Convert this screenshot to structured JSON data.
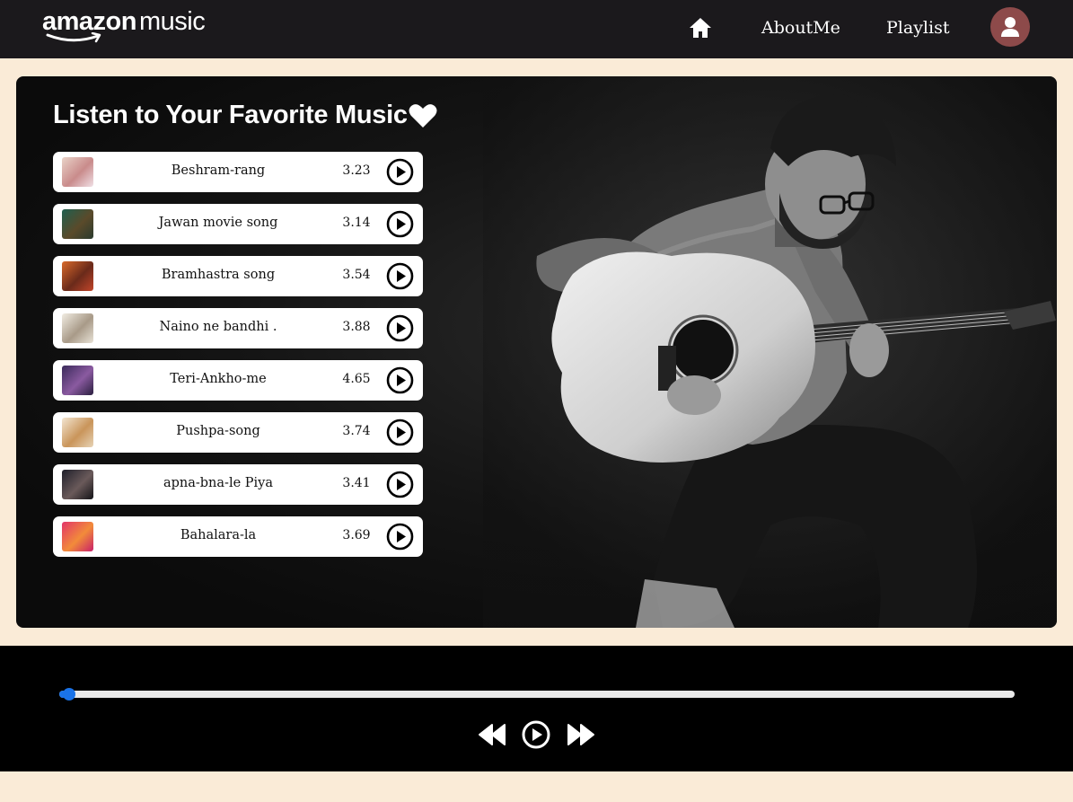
{
  "nav": {
    "logo_brand": "amazon",
    "logo_product": "music",
    "links": [
      "AboutMe",
      "Playlist"
    ],
    "home_icon": "home-icon",
    "profile_icon": "user-icon"
  },
  "hero": {
    "title": "Listen to Your Favorite Music",
    "title_icon": "heart-icon",
    "songs": [
      {
        "name": "Beshram-rang",
        "duration": "3.23"
      },
      {
        "name": "Jawan movie song",
        "duration": "3.14"
      },
      {
        "name": "Bramhastra song",
        "duration": "3.54"
      },
      {
        "name": "Naino ne bandhi .",
        "duration": "3.88"
      },
      {
        "name": "Teri-Ankho-me",
        "duration": "4.65"
      },
      {
        "name": "Pushpa-song",
        "duration": "3.74"
      },
      {
        "name": "apna-bna-le Piya",
        "duration": "3.41"
      },
      {
        "name": "Bahalara-la",
        "duration": "3.69"
      }
    ]
  },
  "player": {
    "progress": 0.01,
    "controls": [
      "backward-icon",
      "play-icon",
      "forward-icon"
    ]
  },
  "colors": {
    "navbar": "#1b191c",
    "page_bg": "#faebd7",
    "accent": "#1a73e8",
    "avatar": "#8d4a4a"
  }
}
